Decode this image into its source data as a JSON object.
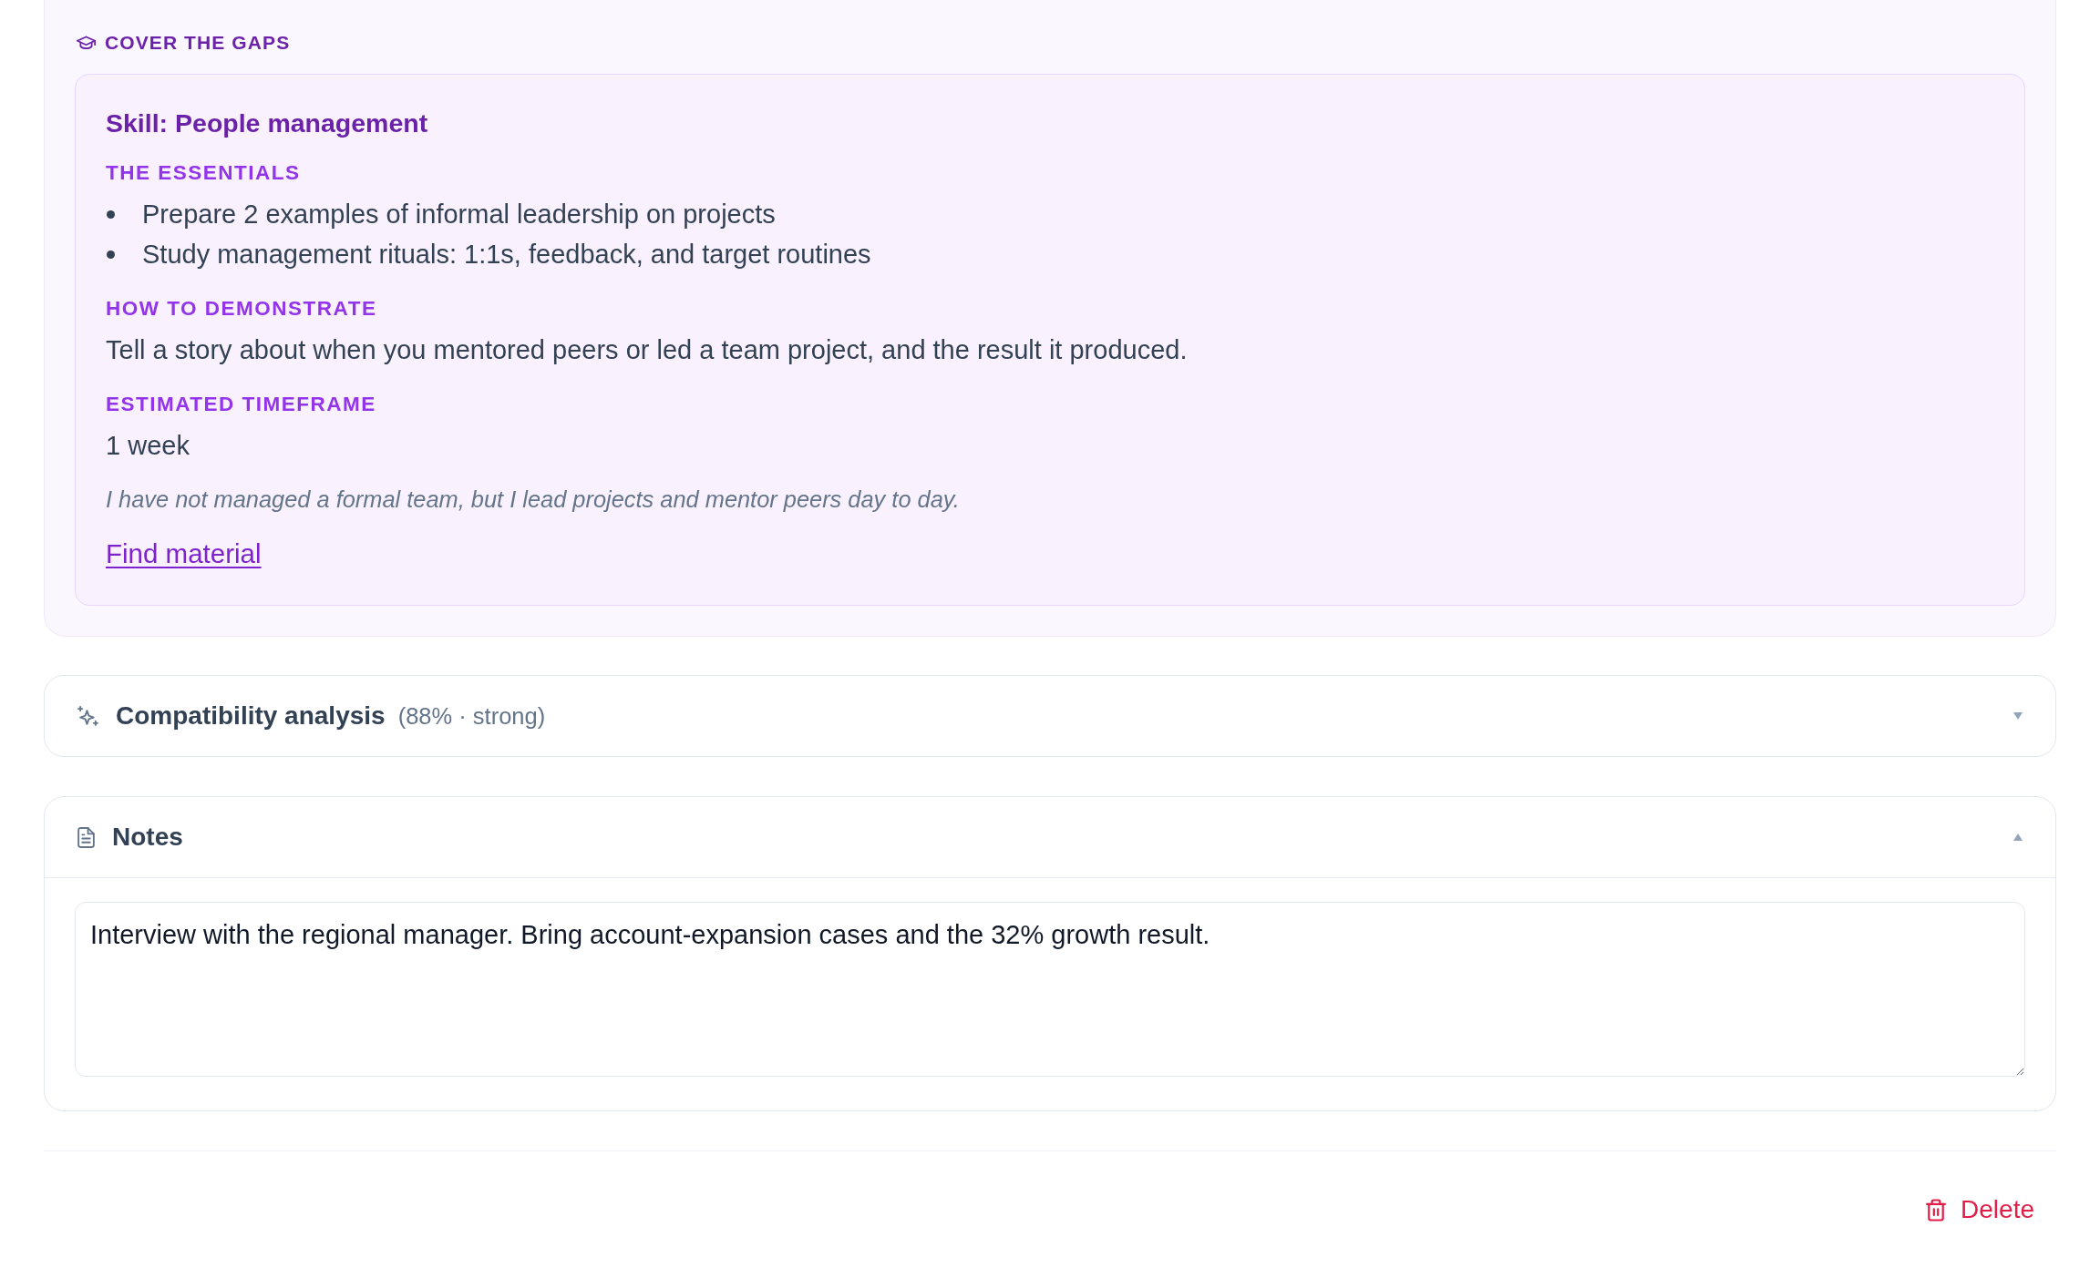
{
  "gaps_panel": {
    "title": "COVER THE GAPS",
    "skill_card": {
      "title": "Skill: People management",
      "sections": [
        {
          "kind": "bullets",
          "heading": "THE ESSENTIALS",
          "items": [
            "Prepare 2 examples of informal leadership on projects",
            "Study management rituals: 1:1s, feedback, and target routines"
          ]
        },
        {
          "kind": "text",
          "heading": "HOW TO DEMONSTRATE",
          "text": "Tell a story about when you mentored peers or led a team project, and the result it produced."
        },
        {
          "kind": "text",
          "heading": "ESTIMATED TIMEFRAME",
          "text": "1 week"
        }
      ],
      "note": "I have not managed a formal team, but I lead projects and mentor peers day to day.",
      "link": "Find material"
    }
  },
  "panels": [
    {
      "kind": "analysis",
      "title": "Compatibility analysis",
      "detail": "(88% · strong)",
      "expanded": false
    },
    {
      "kind": "notes",
      "title": "Notes",
      "expanded": true,
      "value": "Interview with the regional manager. Bring account-expansion cases and the 32% growth result."
    }
  ],
  "delete_button": {
    "label": "Delete"
  }
}
